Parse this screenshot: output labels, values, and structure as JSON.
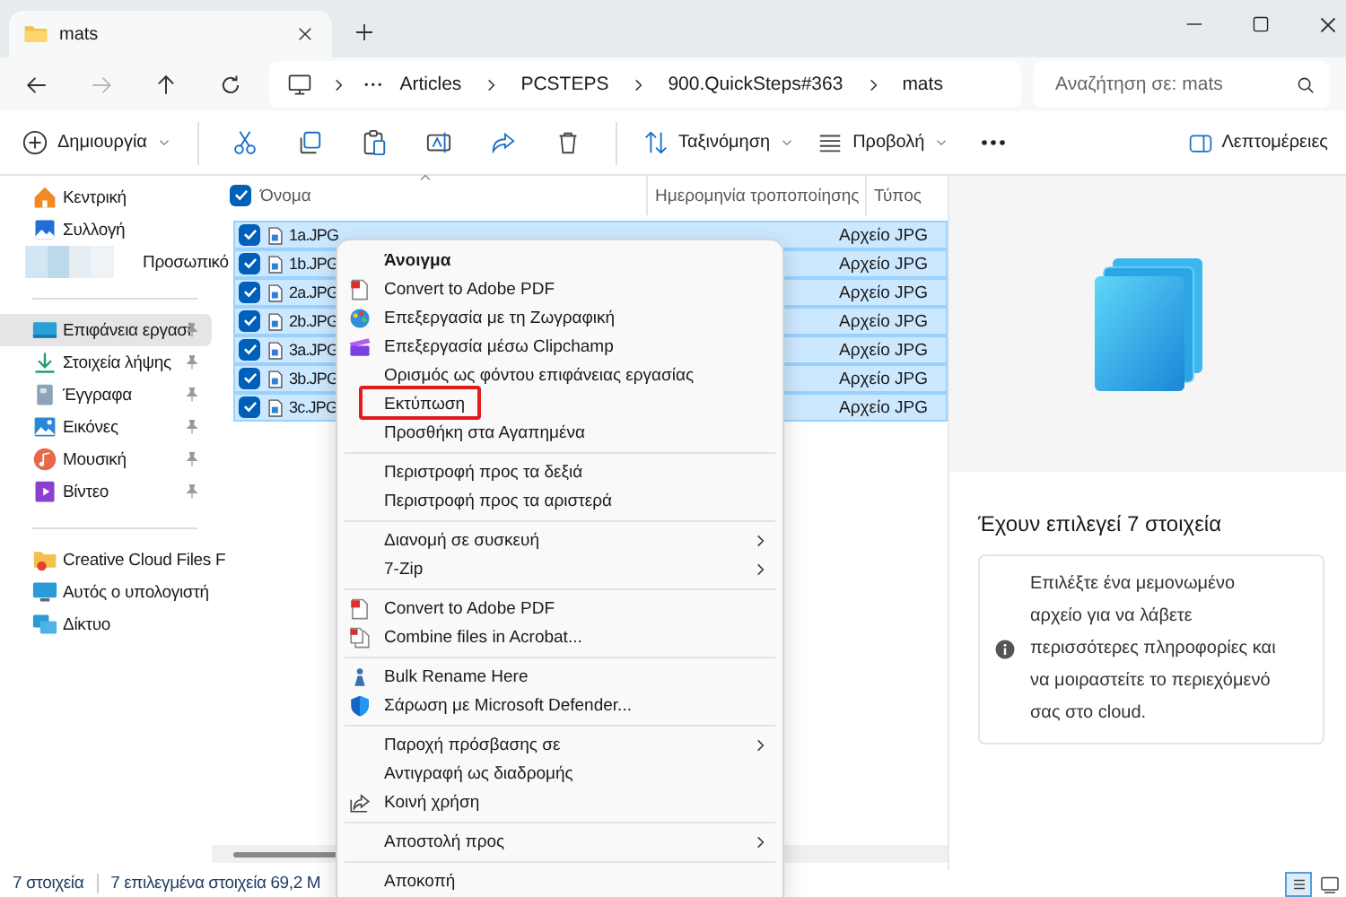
{
  "tab": {
    "title": "mats"
  },
  "nav": [
    {
      "kind": "back",
      "disabled": false
    },
    {
      "kind": "forward",
      "disabled": true
    },
    {
      "kind": "up",
      "disabled": false
    },
    {
      "kind": "refresh",
      "disabled": false
    }
  ],
  "address": {
    "crumbs": [
      "Articles",
      "PCSTEPS",
      "900.QuickSteps#363",
      "mats"
    ]
  },
  "search": {
    "placeholder": "Αναζήτηση σε: mats"
  },
  "toolbar": {
    "groups": [
      [
        {
          "kind": "new",
          "label": "Δημιουργία",
          "dropdown": true
        }
      ],
      [
        {
          "kind": "cut",
          "dropdown": false
        },
        {
          "kind": "copy",
          "dropdown": false
        },
        {
          "kind": "paste",
          "dropdown": false
        },
        {
          "kind": "rename",
          "dropdown": false
        },
        {
          "kind": "share",
          "dropdown": false
        },
        {
          "kind": "delete",
          "dropdown": false
        }
      ],
      [
        {
          "kind": "sort",
          "label": "Ταξινόμηση",
          "dropdown": true
        },
        {
          "kind": "view",
          "label": "Προβολή",
          "dropdown": true
        },
        {
          "kind": "more",
          "dropdown": false
        }
      ]
    ],
    "details": {
      "label": "Λεπτομέρειες"
    }
  },
  "sidebar": {
    "groups": [
      [
        {
          "kind": "home",
          "label": "Κεντρική",
          "pinned": false,
          "selected": false
        },
        {
          "kind": "gallery",
          "label": "Συλλογή",
          "pinned": false,
          "selected": false
        },
        {
          "kind": "blurred",
          "label": "Προσωπικό",
          "pinned": false,
          "selected": false
        }
      ],
      [
        {
          "kind": "desktop",
          "label": "Επιφάνεια εργασί",
          "pinned": true,
          "selected": true
        },
        {
          "kind": "downloads",
          "label": "Στοιχεία λήψης",
          "pinned": true,
          "selected": false
        },
        {
          "kind": "documents",
          "label": "Έγγραφα",
          "pinned": true,
          "selected": false
        },
        {
          "kind": "pictures",
          "label": "Εικόνες",
          "pinned": true,
          "selected": false
        },
        {
          "kind": "music",
          "label": "Μουσική",
          "pinned": true,
          "selected": false
        },
        {
          "kind": "video",
          "label": "Βίντεο",
          "pinned": true,
          "selected": false
        }
      ],
      [
        {
          "kind": "cloud",
          "label": "Creative Cloud Files F",
          "pinned": false,
          "selected": false
        },
        {
          "kind": "pc",
          "label": "Αυτός ο υπολογιστή",
          "pinned": false,
          "selected": false
        },
        {
          "kind": "network",
          "label": "Δίκτυο",
          "pinned": false,
          "selected": false
        }
      ]
    ]
  },
  "file_list": {
    "all_checked": true,
    "columns": [
      "Όνομα",
      "Ημερομηνία τροποποίησης",
      "Τύπος"
    ],
    "rows": [
      {
        "name": "1a.JPG",
        "type": "Αρχείο JPG",
        "selected": true
      },
      {
        "name": "1b.JPG",
        "type": "Αρχείο JPG",
        "selected": true
      },
      {
        "name": "2a.JPG",
        "type": "Αρχείο JPG",
        "selected": true
      },
      {
        "name": "2b.JPG",
        "type": "Αρχείο JPG",
        "selected": true
      },
      {
        "name": "3a.JPG",
        "type": "Αρχείο JPG",
        "selected": true
      },
      {
        "name": "3b.JPG",
        "type": "Αρχείο JPG",
        "selected": true
      },
      {
        "name": "3c.JPG",
        "type": "Αρχείο JPG",
        "selected": true
      }
    ]
  },
  "context_menu": {
    "groups": [
      [
        {
          "kind": "plain",
          "label": "Άνοιγμα",
          "bold": true,
          "submenu": false,
          "highlighted": false
        },
        {
          "kind": "pdf",
          "label": "Convert to Adobe PDF",
          "bold": false,
          "submenu": false,
          "highlighted": false
        },
        {
          "kind": "paint",
          "label": "Επεξεργασία με τη Ζωγραφική",
          "bold": false,
          "submenu": false,
          "highlighted": false
        },
        {
          "kind": "clipchamp",
          "label": "Επεξεργασία μέσω Clipchamp",
          "bold": false,
          "submenu": false,
          "highlighted": false
        },
        {
          "kind": "plain",
          "label": "Ορισμός ως φόντου επιφάνειας εργασίας",
          "bold": false,
          "submenu": false,
          "highlighted": false
        },
        {
          "kind": "plain",
          "label": "Εκτύπωση",
          "bold": false,
          "submenu": false,
          "highlighted": true
        },
        {
          "kind": "plain",
          "label": "Προσθήκη στα Αγαπημένα",
          "bold": false,
          "submenu": false,
          "highlighted": false
        }
      ],
      [
        {
          "kind": "plain",
          "label": "Περιστροφή προς τα δεξιά",
          "bold": false,
          "submenu": false,
          "highlighted": false
        },
        {
          "kind": "plain",
          "label": "Περιστροφή προς τα αριστερά",
          "bold": false,
          "submenu": false,
          "highlighted": false
        }
      ],
      [
        {
          "kind": "plain",
          "label": "Διανομή σε συσκευή",
          "bold": false,
          "submenu": true,
          "highlighted": false
        },
        {
          "kind": "plain",
          "label": "7-Zip",
          "bold": false,
          "submenu": true,
          "highlighted": false
        }
      ],
      [
        {
          "kind": "pdf",
          "label": "Convert to Adobe PDF",
          "bold": false,
          "submenu": false,
          "highlighted": false
        },
        {
          "kind": "combine",
          "label": "Combine files in Acrobat...",
          "bold": false,
          "submenu": false,
          "highlighted": false
        }
      ],
      [
        {
          "kind": "bulk",
          "label": "Bulk Rename Here",
          "bold": false,
          "submenu": false,
          "highlighted": false
        },
        {
          "kind": "shield",
          "label": "Σάρωση με Microsoft Defender...",
          "bold": false,
          "submenu": false,
          "highlighted": false
        }
      ],
      [
        {
          "kind": "plain",
          "label": "Παροχή πρόσβασης σε",
          "bold": false,
          "submenu": true,
          "highlighted": false
        },
        {
          "kind": "plain",
          "label": "Αντιγραφή ως διαδρομής",
          "bold": false,
          "submenu": false,
          "highlighted": false
        },
        {
          "kind": "share",
          "label": "Κοινή χρήση",
          "bold": false,
          "submenu": false,
          "highlighted": false
        }
      ],
      [
        {
          "kind": "plain",
          "label": "Αποστολή προς",
          "bold": false,
          "submenu": true,
          "highlighted": false
        }
      ],
      [
        {
          "kind": "plain",
          "label": "Αποκοπή",
          "bold": false,
          "submenu": false,
          "highlighted": false
        }
      ]
    ]
  },
  "details_pane": {
    "title": "Έχουν επιλεγεί 7 στοιχεία",
    "info": "Επιλέξτε ένα μεμονωμένο αρχείο για να λάβετε περισσότερες πληροφορίες και να μοιραστείτε το περιεχόμενό σας στο cloud."
  },
  "status_bar": {
    "count": "7 στοιχεία",
    "selection": "7 επιλεγμένα στοιχεία  69,2 M",
    "view_modes": [
      {
        "kind": "list",
        "selected": true
      },
      {
        "kind": "tiles",
        "selected": false
      }
    ]
  }
}
